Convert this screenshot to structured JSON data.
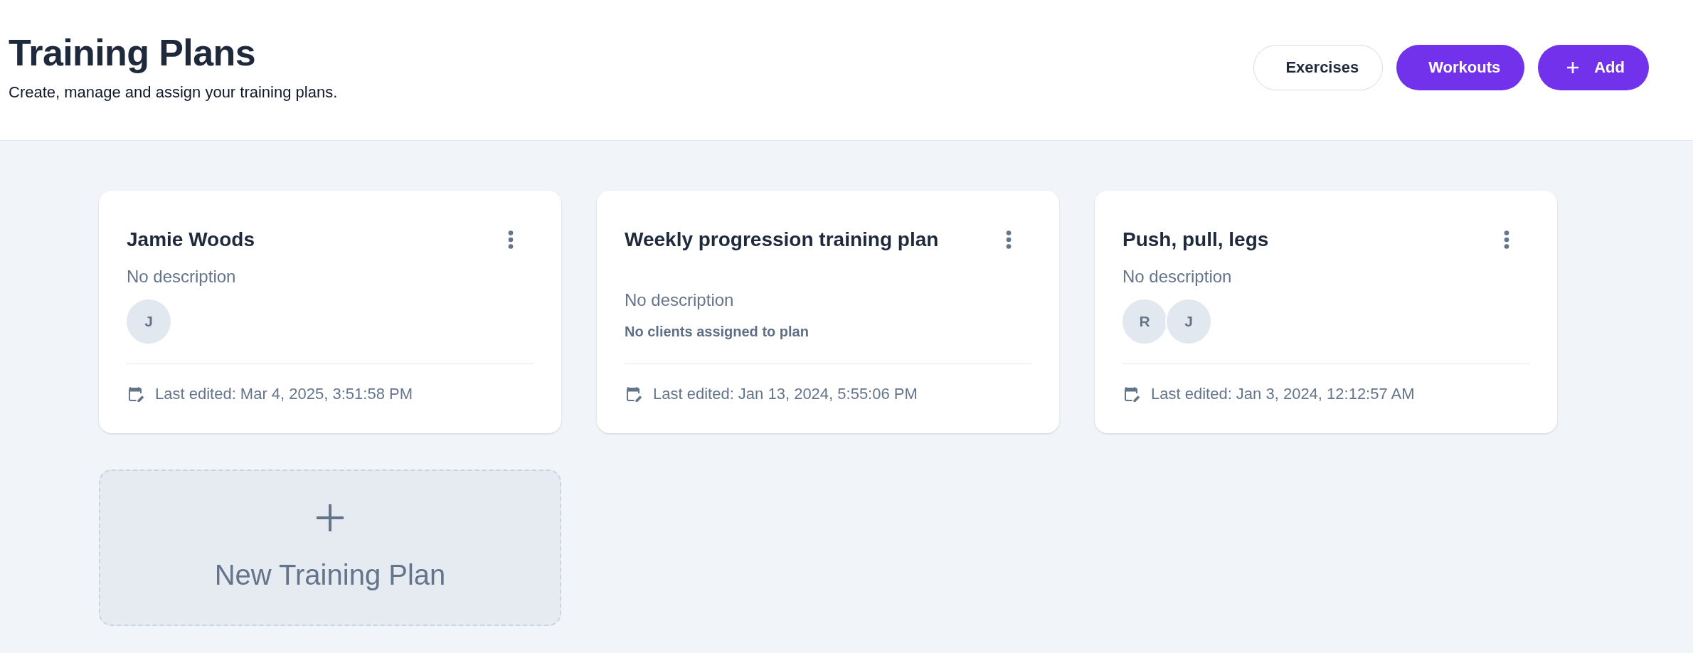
{
  "header": {
    "title": "Training Plans",
    "subtitle": "Create, manage and assign your training plans."
  },
  "actions": [
    {
      "label": "Exercises",
      "kind": "outline"
    },
    {
      "label": "Workouts",
      "kind": "filled"
    },
    {
      "label": "Add",
      "kind": "filled-add"
    }
  ],
  "plans": [
    {
      "name": "Jamie Woods",
      "description": "No description",
      "clients": [
        "J"
      ],
      "last_edited": "Last edited: Mar 4, 2025, 3:51:58 PM"
    },
    {
      "name": "Weekly progression training plan",
      "description": "No description",
      "clients_note": "No clients assigned to plan",
      "last_edited": "Last edited: Jan 13, 2024, 5:55:06 PM"
    },
    {
      "name": "Push, pull, legs",
      "description": "No description",
      "clients": [
        "R",
        "J"
      ],
      "last_edited": "Last edited: Jan 3, 2024, 12:12:57 AM"
    }
  ],
  "new_plan": {
    "label": "New Training Plan"
  }
}
